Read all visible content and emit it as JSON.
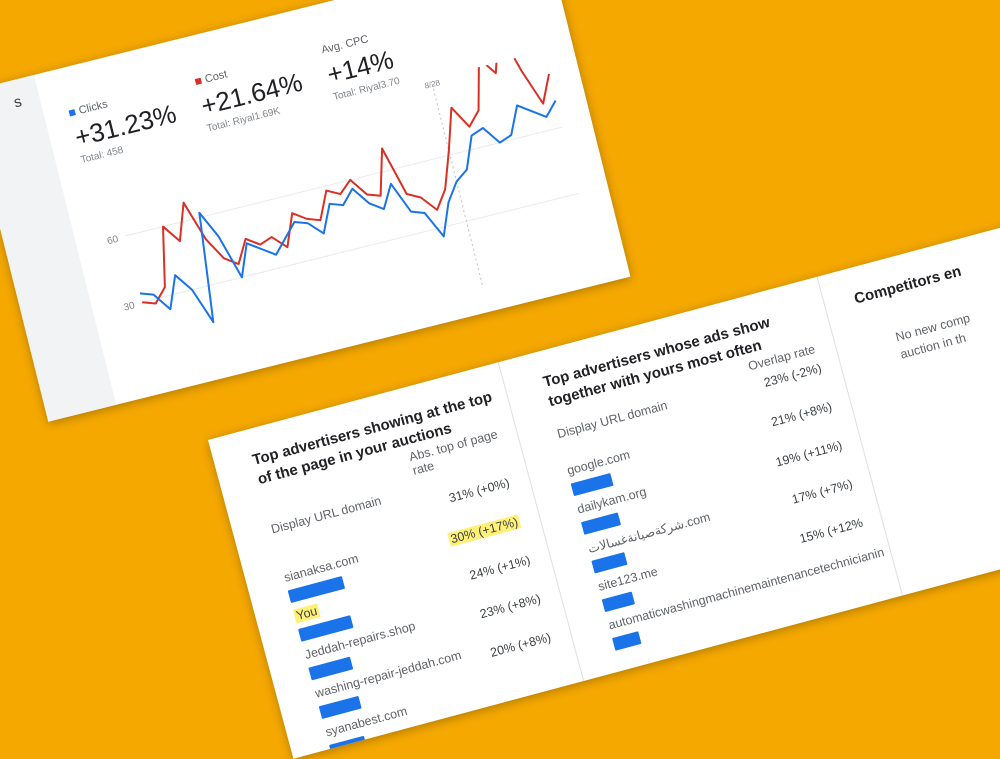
{
  "summary": {
    "section_title_fragment": "s",
    "metrics": [
      {
        "label": "Clicks",
        "value": "+31.23%",
        "sub": "Total: 458",
        "color": "#1a73e8"
      },
      {
        "label": "Cost",
        "value": "+21.64%",
        "sub": "Total: Riyal1.69K",
        "color": "#d93025"
      },
      {
        "label": "Avg. CPC",
        "value": "+14%",
        "sub": "Total: Riyal3.70",
        "color": ""
      }
    ]
  },
  "chart_data": {
    "type": "line",
    "yticks": [
      "60",
      "30"
    ],
    "ylim": [
      0,
      90
    ],
    "marker_label": "8/28",
    "marker_index": 26,
    "series": [
      {
        "color": "#d93025",
        "values": [
          30,
          28,
          34,
          60,
          52,
          68,
          50,
          40,
          36,
          46,
          42,
          44,
          38,
          52,
          48,
          46,
          58,
          55,
          60,
          52,
          50,
          70,
          48,
          45,
          38,
          46,
          62,
          80,
          70,
          76,
          98,
          90,
          108,
          88,
          72,
          84
        ]
      },
      {
        "color": "#1a73e8",
        "values": [
          34,
          32,
          24,
          38,
          30,
          14,
          62,
          50,
          30,
          44,
          40,
          36,
          42,
          48,
          46,
          40,
          52,
          50,
          56,
          48,
          44,
          54,
          40,
          38,
          26,
          40,
          48,
          52,
          66,
          68,
          60,
          62,
          74,
          70,
          66,
          72
        ]
      }
    ]
  },
  "top_of_page": {
    "title": "Top advertisers showing at the top of the page in your auctions",
    "col_domain": "Display URL domain",
    "col_rate": "Abs. top of page rate",
    "rows": [
      {
        "domain": "sianaksa.com",
        "rate": "31% (+0%)",
        "bar": 0.62,
        "you": false
      },
      {
        "domain": "You",
        "rate": "30% (+17%)",
        "bar": 0.6,
        "you": true
      },
      {
        "domain": "Jeddah-repairs.shop",
        "rate": "24% (+1%)",
        "bar": 0.48,
        "you": false
      },
      {
        "domain": "washing-repair-jeddah.com",
        "rate": "23% (+8%)",
        "bar": 0.46,
        "you": false
      },
      {
        "domain": "syanabest.com",
        "rate": "20% (+8%)",
        "bar": 0.4,
        "you": false
      }
    ]
  },
  "overlap": {
    "title": "Top advertisers whose ads show together with yours most often",
    "col_domain": "Display URL domain",
    "col_rate": "Overlap rate",
    "rows": [
      {
        "domain": "google.com",
        "rate": "23% (-2%)",
        "bar": 0.46
      },
      {
        "domain": "dailykam.org",
        "rate": "21% (+8%)",
        "bar": 0.42
      },
      {
        "domain": "شركةصيانةغسالات.com",
        "rate": "19% (+11%)",
        "bar": 0.38
      },
      {
        "domain": "site123.me",
        "rate": "17% (+7%)",
        "bar": 0.34
      },
      {
        "domain": "automaticwashingmachinemaintenancetechnicianin",
        "rate": "15% (+12%",
        "bar": 0.3
      }
    ]
  },
  "competitors": {
    "title": "Competitors en",
    "empty_line1": "No new comp",
    "empty_line2": "auction in th"
  }
}
